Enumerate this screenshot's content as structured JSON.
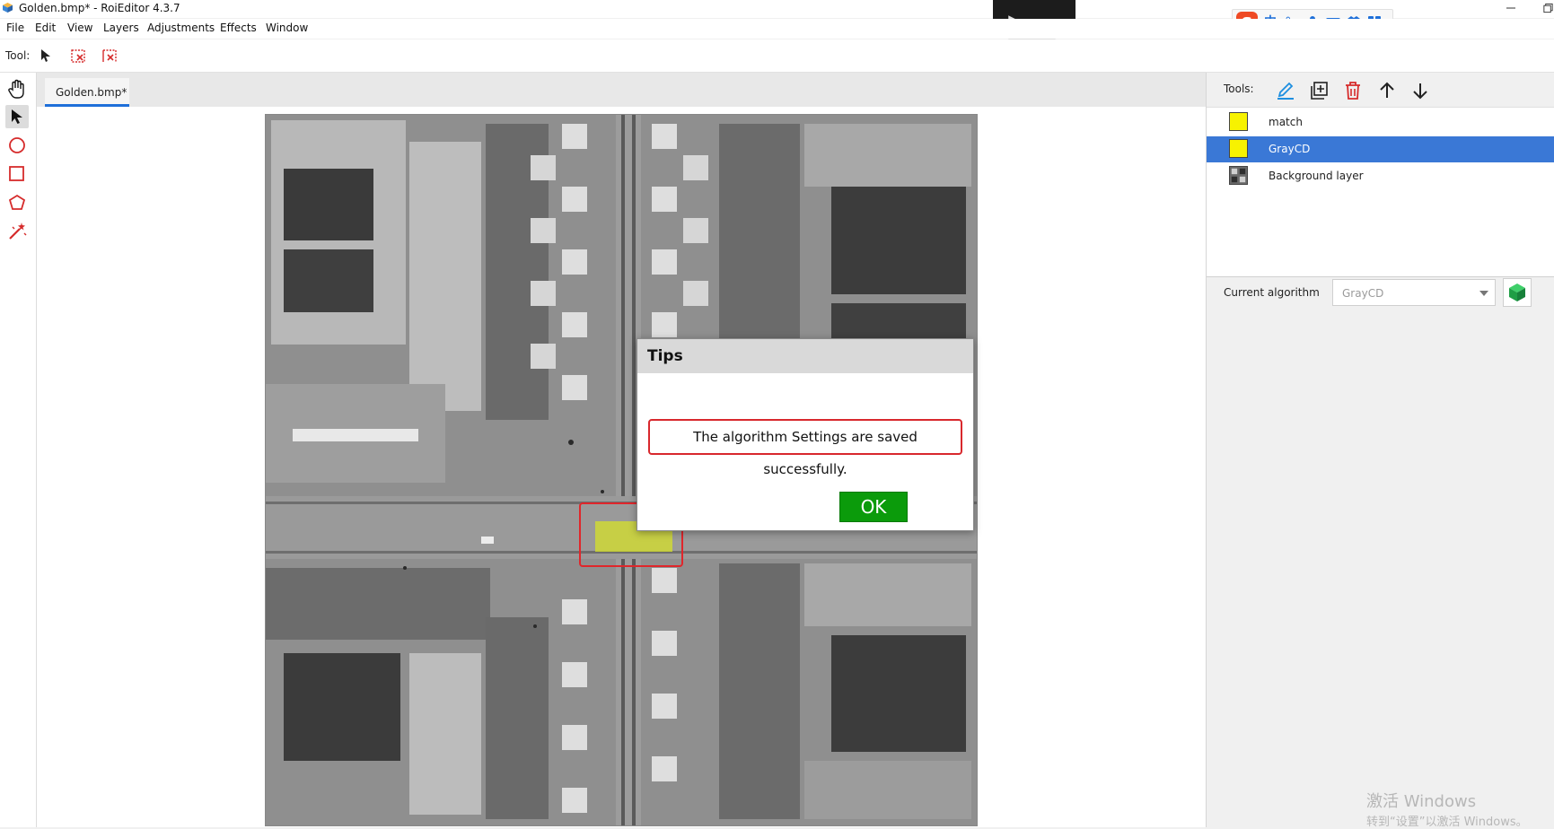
{
  "window": {
    "title": "Golden.bmp* - RoiEditor 4.3.7"
  },
  "ime": {
    "logo": "S",
    "items": [
      "中",
      "°,",
      "mic-icon",
      "keyboard-icon",
      "shirt-icon",
      "grid-icon"
    ]
  },
  "menu": [
    "File",
    "Edit",
    "View",
    "Layers",
    "Adjustments",
    "Effects",
    "Window"
  ],
  "toolbar": {
    "tool_label": "Tool:"
  },
  "left_tools": [
    "hand-icon",
    "arrow-select-icon",
    "circle-icon",
    "rectangle-icon",
    "polygon-icon",
    "magic-wand-icon"
  ],
  "document": {
    "tab_label": "Golden.bmp*"
  },
  "dialog": {
    "title": "Tips",
    "message": "The algorithm Settings are saved successfully.",
    "ok_label": "OK"
  },
  "right_panel": {
    "tools_label": "Tools:",
    "layers": [
      {
        "name": "match",
        "selected": false
      },
      {
        "name": "GrayCD",
        "selected": true
      },
      {
        "name": "Background layer",
        "selected": false
      }
    ],
    "algorithm_label": "Current algorithm",
    "algorithm_value": "GrayCD"
  },
  "colors": {
    "selection": "#3a78d6",
    "accent": "#1e6fd9",
    "roi_highlight": "#e0262b",
    "ok_button": "#0b9b0b",
    "layer_swatch": "#f7f200"
  },
  "watermark": {
    "line1": "激活 Windows",
    "line2": "转到“设置”以激活 Windows。"
  }
}
